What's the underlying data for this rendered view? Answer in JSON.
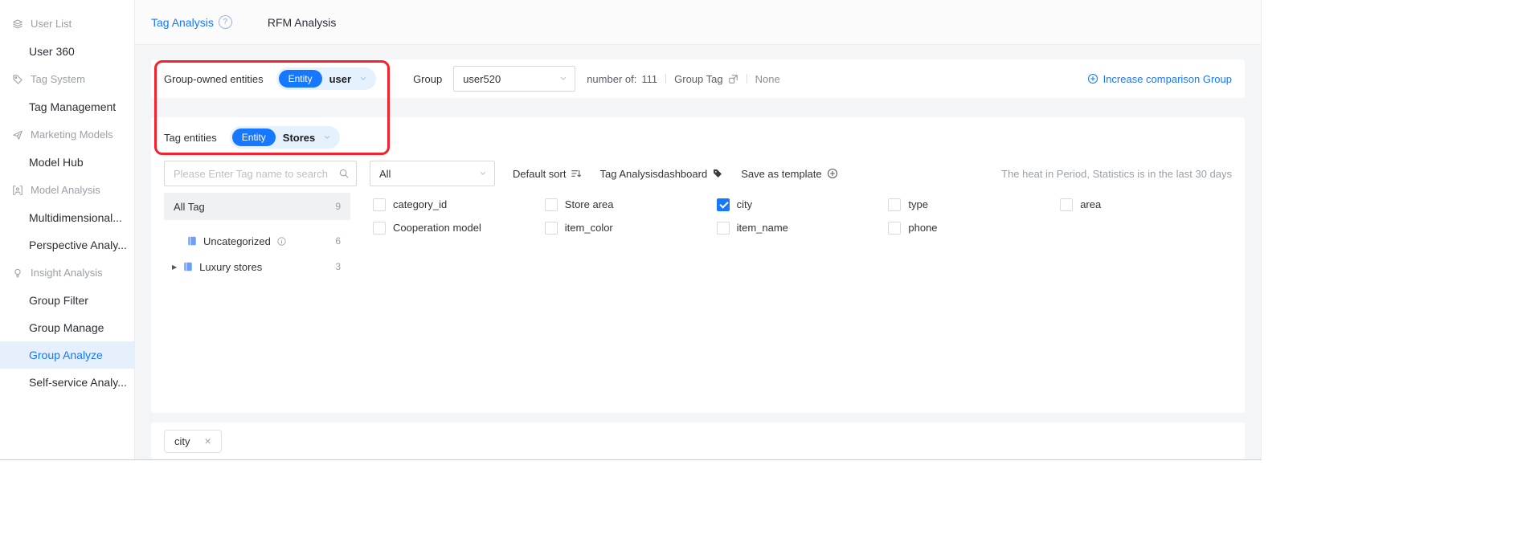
{
  "colors": {
    "accent": "#1677ff",
    "annotation": "#f5222d",
    "entity_select_bg": "#e6f1fe",
    "sidebar_active_bg": "#e6f0fd"
  },
  "icons": {
    "close": "×",
    "help": "?",
    "caret_right": "▶"
  },
  "sidebar": {
    "sections": [
      {
        "icon": "layers-icon",
        "label": "User List",
        "items": [
          {
            "label": "User 360"
          }
        ]
      },
      {
        "icon": "tag-icon",
        "label": "Tag System",
        "items": [
          {
            "label": "Tag Management"
          }
        ]
      },
      {
        "icon": "send-icon",
        "label": "Marketing Models",
        "items": [
          {
            "label": "Model Hub"
          }
        ]
      },
      {
        "icon": "model-icon",
        "label": "Model Analysis",
        "items": [
          {
            "label": "Multidimensional..."
          },
          {
            "label": "Perspective Analy..."
          }
        ]
      },
      {
        "icon": "insight-icon",
        "label": "Insight Analysis",
        "items": [
          {
            "label": "Group Filter"
          },
          {
            "label": "Group Manage"
          },
          {
            "label": "Group Analyze",
            "active": true
          },
          {
            "label": "Self-service Analy..."
          }
        ]
      }
    ]
  },
  "tabs": {
    "tag_analysis": "Tag Analysis",
    "tag_analysis_active": true,
    "rfm_analysis": "RFM Analysis"
  },
  "group_panel": {
    "group_owned_label": "Group-owned entities",
    "entity_badge": "Entity",
    "group_owned_value": "user",
    "group_label": "Group",
    "group_value": "user520",
    "number_of_label": "number of:",
    "number_of_value": "111",
    "group_tag_label": "Group Tag",
    "group_tag_value": "None",
    "increase_comparison_label": "Increase comparison Group"
  },
  "tag_panel": {
    "tag_entities_label": "Tag entities",
    "entity_badge": "Entity",
    "tag_entities_value": "Stores",
    "search_placeholder": "Please Enter Tag name to search",
    "category_filter_value": "All",
    "sort_label": "Default sort",
    "dashboard_label": "Tag Analysisdashboard",
    "save_template_label": "Save as template",
    "period_note": "The heat in Period, Statistics is in the last 30 days",
    "tree": {
      "all_tag_label": "All Tag",
      "all_tag_count": "9",
      "nodes": [
        {
          "label": "Uncategorized",
          "count": "6",
          "has_info": true
        },
        {
          "label": "Luxury stores",
          "count": "3",
          "expandable": true
        }
      ]
    },
    "tags": [
      {
        "label": "category_id",
        "checked": false
      },
      {
        "label": "Store area",
        "checked": false
      },
      {
        "label": "city",
        "checked": true
      },
      {
        "label": "type",
        "checked": false
      },
      {
        "label": "area",
        "checked": false
      },
      {
        "label": "Cooperation model",
        "checked": false
      },
      {
        "label": "item_color",
        "checked": false
      },
      {
        "label": "item_name",
        "checked": false
      },
      {
        "label": "phone",
        "checked": false
      }
    ]
  },
  "selected_bar": {
    "chips": [
      {
        "label": "city"
      }
    ]
  }
}
